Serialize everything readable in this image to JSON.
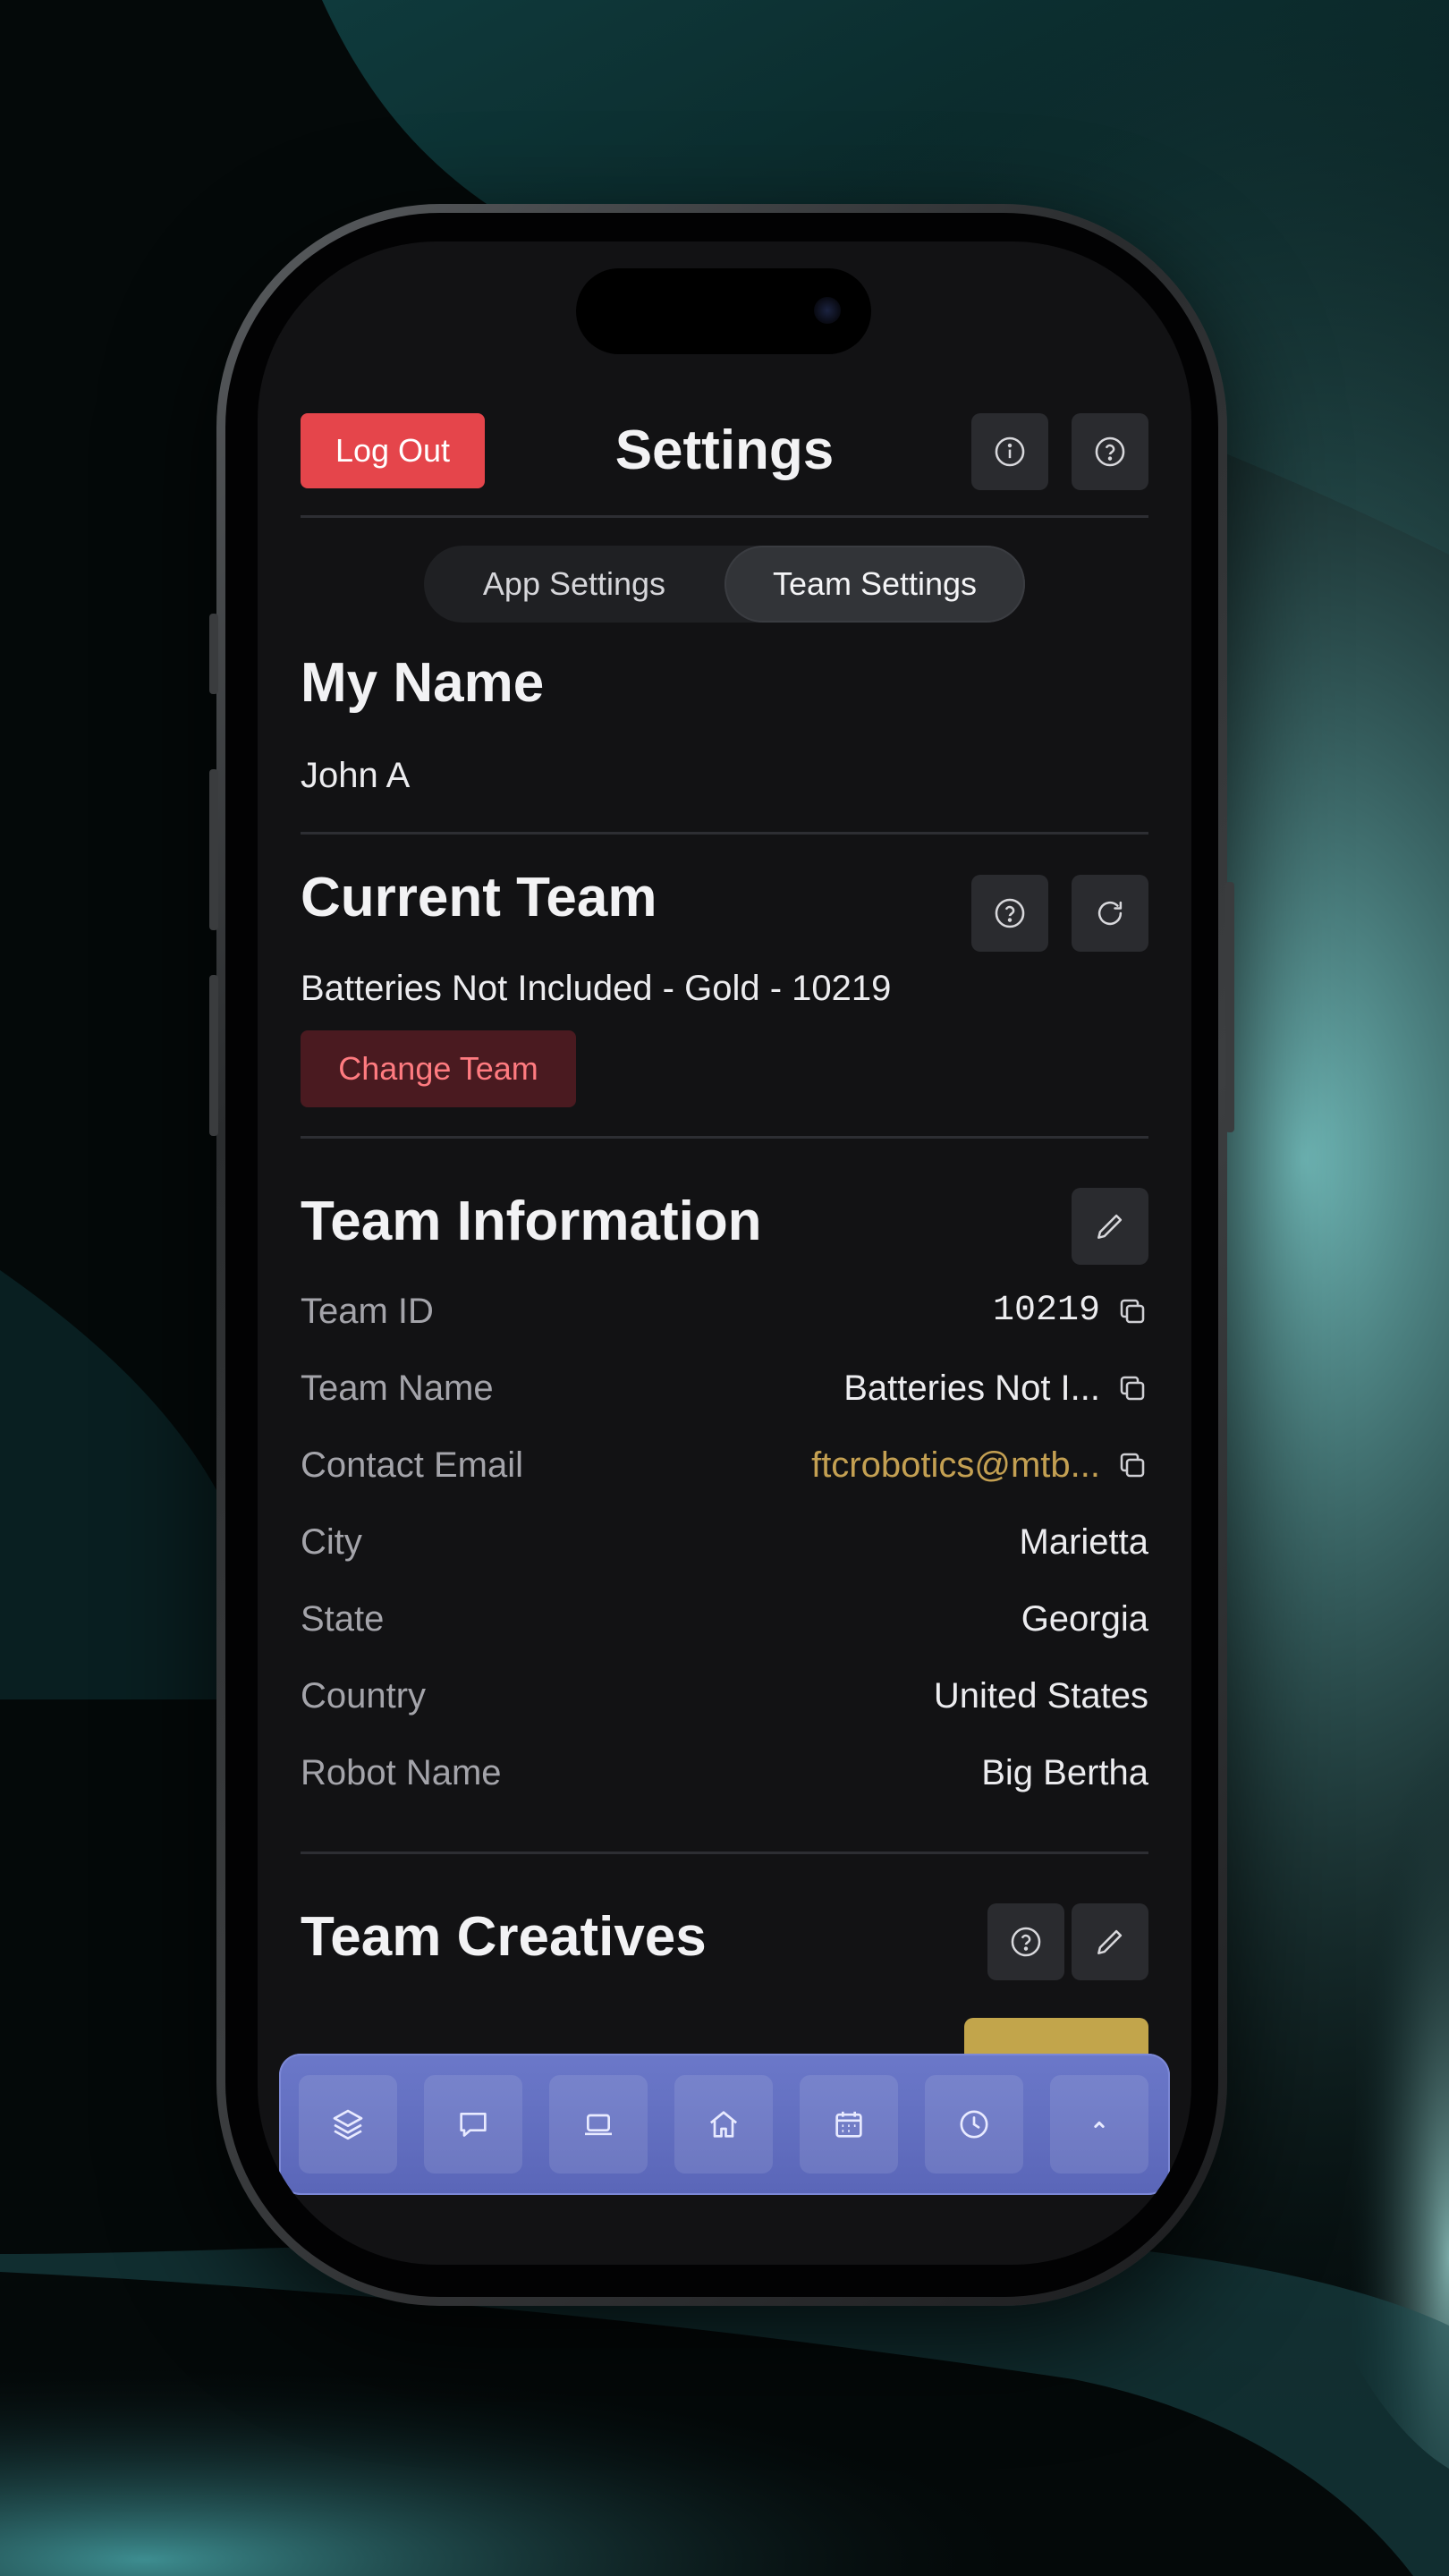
{
  "header": {
    "logout_label": "Log Out",
    "title": "Settings",
    "info_icon": "info-icon",
    "help_icon": "question-icon"
  },
  "tabs": [
    {
      "label": "App Settings",
      "active": false
    },
    {
      "label": "Team Settings",
      "active": true
    }
  ],
  "my_name": {
    "heading": "My Name",
    "value": "John A"
  },
  "current_team": {
    "heading": "Current Team",
    "value": "Batteries Not Included - Gold - 10219",
    "change_label": "Change Team"
  },
  "team_information": {
    "heading": "Team Information",
    "rows": [
      {
        "label": "Team ID",
        "value": "10219"
      },
      {
        "label": "Team Name",
        "value": "Batteries Not I..."
      },
      {
        "label": "Contact Email",
        "value": "ftcrobotics@mtb..."
      },
      {
        "label": "City",
        "value": "Marietta"
      },
      {
        "label": "State",
        "value": "Georgia"
      },
      {
        "label": "Country",
        "value": "United States"
      },
      {
        "label": "Robot Name",
        "value": "Big Bertha"
      }
    ]
  },
  "team_creatives": {
    "heading": "Team Creatives"
  },
  "bottom_nav": {
    "items": [
      "layers-icon",
      "chat-icon",
      "tablet-icon",
      "home-icon",
      "calendar-icon",
      "clock-icon",
      "chevron-up-icon"
    ]
  },
  "colors": {
    "logout": "#e5454b",
    "change_team_bg": "#4a1a20",
    "change_team_text": "#ff7b80",
    "email": "#c4a052",
    "nav_bar": "#6b78c9",
    "screen_bg": "#121214"
  }
}
